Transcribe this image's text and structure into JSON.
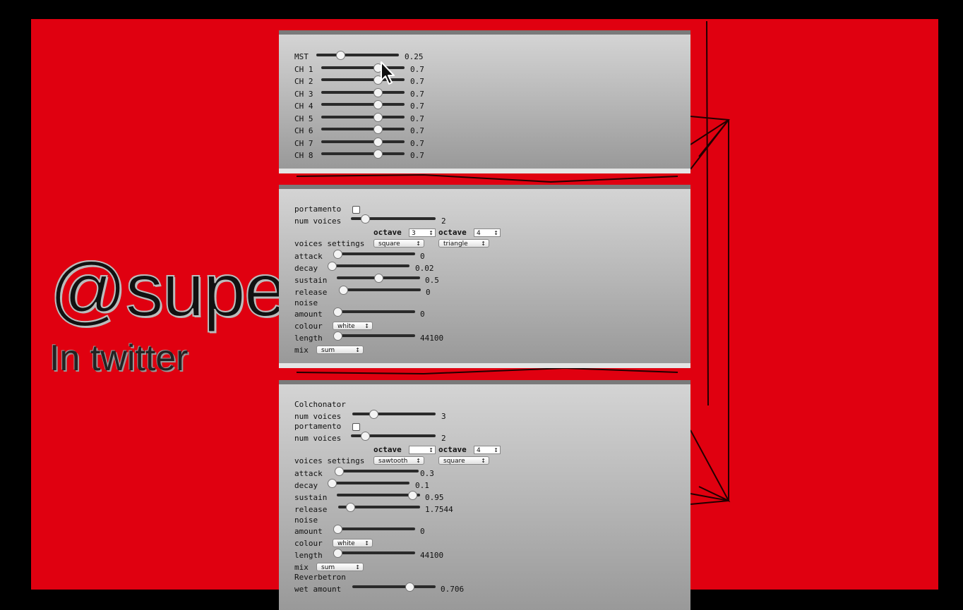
{
  "slide": {
    "handle": "@supe",
    "subtitle": "In twitter"
  },
  "mixer": {
    "rows": [
      {
        "label": "MST",
        "value": "0.25"
      },
      {
        "label": "CH 1",
        "value": "0.7"
      },
      {
        "label": "CH 2",
        "value": "0.7"
      },
      {
        "label": "CH 3",
        "value": "0.7"
      },
      {
        "label": "CH 4",
        "value": "0.7"
      },
      {
        "label": "CH 5",
        "value": "0.7"
      },
      {
        "label": "CH 6",
        "value": "0.7"
      },
      {
        "label": "CH 7",
        "value": "0.7"
      },
      {
        "label": "CH 8",
        "value": "0.7"
      }
    ]
  },
  "synth1": {
    "portamento": "portamento",
    "num_voices": {
      "label": "num voices",
      "value": "2"
    },
    "octave_label": "octave",
    "octave1": "3",
    "octave2": "4",
    "voices_settings": "voices settings",
    "wave1": "square",
    "wave2": "triangle",
    "attack": {
      "label": "attack",
      "value": "0"
    },
    "decay": {
      "label": "decay",
      "value": "0.02"
    },
    "sustain": {
      "label": "sustain",
      "value": "0.5"
    },
    "release": {
      "label": "release",
      "value": "0"
    },
    "noise": "noise",
    "amount": {
      "label": "amount",
      "value": "0"
    },
    "colour": {
      "label": "colour",
      "value": "white"
    },
    "length": {
      "label": "length",
      "value": "44100"
    },
    "mix": {
      "label": "mix",
      "value": "sum"
    }
  },
  "synth2": {
    "title": "Colchonator",
    "num_voices_top": {
      "label": "num voices",
      "value": "3"
    },
    "portamento": "portamento",
    "num_voices": {
      "label": "num voices",
      "value": "2"
    },
    "octave_label": "octave",
    "octave1": "",
    "octave2": "4",
    "voices_settings": "voices settings",
    "wave1": "sawtooth",
    "wave2": "square",
    "attack": {
      "label": "attack",
      "value": "0.3"
    },
    "decay": {
      "label": "decay",
      "value": "0.1"
    },
    "sustain": {
      "label": "sustain",
      "value": "0.95"
    },
    "release": {
      "label": "release",
      "value": "1.7544"
    },
    "noise": "noise",
    "amount": {
      "label": "amount",
      "value": "0"
    },
    "colour": {
      "label": "colour",
      "value": "white"
    },
    "length": {
      "label": "length",
      "value": "44100"
    },
    "mix": {
      "label": "mix",
      "value": "sum"
    },
    "reverb": "Reverbetron",
    "wet_amount": {
      "label": "wet amount",
      "value": "0.706"
    }
  }
}
